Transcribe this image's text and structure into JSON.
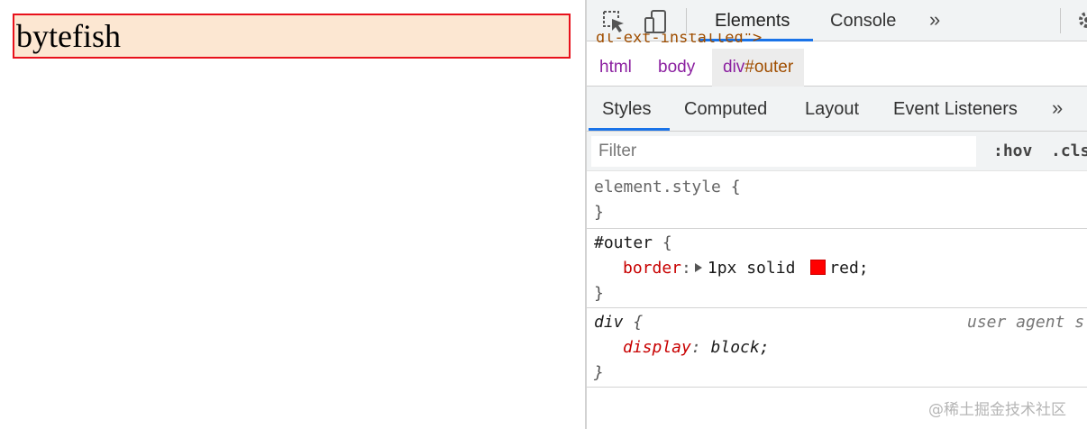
{
  "page": {
    "outer_text": "bytefish",
    "outer_bg": "#fce7d2",
    "outer_border_color": "#e8111b"
  },
  "devtools": {
    "toolbar": {
      "icons": [
        "inspect-element-icon",
        "device-toolbar-icon",
        "settings-gear-icon"
      ],
      "tabs": [
        {
          "label": "Elements",
          "active": true
        },
        {
          "label": "Console",
          "active": false
        }
      ],
      "more": "»"
    },
    "dom_clip_text": "dl-ext-installed\">",
    "breadcrumbs": [
      {
        "label": "html"
      },
      {
        "label": "body"
      },
      {
        "tag": "div",
        "id": "#outer",
        "selected": true
      }
    ],
    "subtabs": [
      {
        "label": "Styles",
        "active": true
      },
      {
        "label": "Computed"
      },
      {
        "label": "Layout"
      },
      {
        "label": "Event Listeners"
      }
    ],
    "subtabs_more": "»",
    "filter": {
      "placeholder": "Filter",
      "hov": ":hov",
      "cls": ".cls"
    },
    "rules": [
      {
        "selector": "element.style",
        "open": "{",
        "close": "}"
      },
      {
        "selector": "#outer",
        "open": "{",
        "close": "}",
        "prop": "border",
        "value_a": "1px solid",
        "swatch": "#ff0000",
        "value_b": "red;"
      },
      {
        "selector": "div",
        "open": "{",
        "close": "}",
        "source": "user agent s",
        "prop": "display",
        "value": "block;"
      }
    ]
  },
  "watermark": "@稀土掘金技术社区",
  "colors": {
    "accent_blue": "#1a73e8",
    "toolbar_bg": "#f1f3f4",
    "crumb_purple": "#8b1fa0",
    "crumb_brown": "#a04e00",
    "css_prop_red": "#c80000"
  }
}
